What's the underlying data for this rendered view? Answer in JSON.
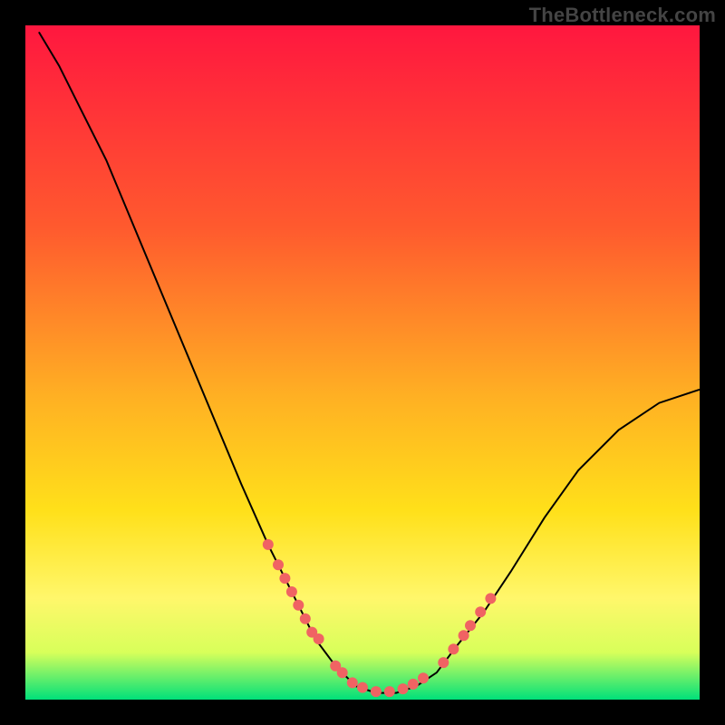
{
  "attribution": "TheBottleneck.com",
  "chart_data": {
    "type": "line",
    "title": "",
    "xlabel": "",
    "ylabel": "",
    "xlim": [
      0,
      100
    ],
    "ylim": [
      0,
      100
    ],
    "gradient_bg": {
      "top": "#ff173f",
      "upper_mid": "#ff8a2a",
      "mid": "#ffd31a",
      "lower_mid": "#fff76b",
      "bottom": "#00e07a"
    },
    "curve": [
      {
        "x": 2,
        "y": 99
      },
      {
        "x": 5,
        "y": 94
      },
      {
        "x": 8,
        "y": 88
      },
      {
        "x": 12,
        "y": 80
      },
      {
        "x": 17,
        "y": 68
      },
      {
        "x": 22,
        "y": 56
      },
      {
        "x": 27,
        "y": 44
      },
      {
        "x": 32,
        "y": 32
      },
      {
        "x": 36,
        "y": 23
      },
      {
        "x": 40,
        "y": 15
      },
      {
        "x": 43,
        "y": 9
      },
      {
        "x": 46,
        "y": 5
      },
      {
        "x": 49,
        "y": 2
      },
      {
        "x": 52,
        "y": 1
      },
      {
        "x": 55,
        "y": 1
      },
      {
        "x": 58,
        "y": 2
      },
      {
        "x": 61,
        "y": 4
      },
      {
        "x": 64,
        "y": 8
      },
      {
        "x": 68,
        "y": 13
      },
      {
        "x": 72,
        "y": 19
      },
      {
        "x": 77,
        "y": 27
      },
      {
        "x": 82,
        "y": 34
      },
      {
        "x": 88,
        "y": 40
      },
      {
        "x": 94,
        "y": 44
      },
      {
        "x": 100,
        "y": 46
      }
    ],
    "marker_clusters": {
      "color": "#f06363",
      "left": [
        {
          "x": 36,
          "y": 23
        },
        {
          "x": 37.5,
          "y": 20
        },
        {
          "x": 38.5,
          "y": 18
        },
        {
          "x": 39.5,
          "y": 16
        },
        {
          "x": 40.5,
          "y": 14
        },
        {
          "x": 41.5,
          "y": 12
        },
        {
          "x": 42.5,
          "y": 10
        },
        {
          "x": 43.5,
          "y": 9
        }
      ],
      "bottom": [
        {
          "x": 46,
          "y": 5
        },
        {
          "x": 47,
          "y": 4
        },
        {
          "x": 48.5,
          "y": 2.5
        },
        {
          "x": 50,
          "y": 1.8
        },
        {
          "x": 52,
          "y": 1.2
        },
        {
          "x": 54,
          "y": 1.2
        },
        {
          "x": 56,
          "y": 1.6
        },
        {
          "x": 57.5,
          "y": 2.3
        },
        {
          "x": 59,
          "y": 3.2
        }
      ],
      "right": [
        {
          "x": 62,
          "y": 5.5
        },
        {
          "x": 63.5,
          "y": 7.5
        },
        {
          "x": 65,
          "y": 9.5
        },
        {
          "x": 66,
          "y": 11
        },
        {
          "x": 67.5,
          "y": 13
        },
        {
          "x": 69,
          "y": 15
        }
      ]
    }
  }
}
